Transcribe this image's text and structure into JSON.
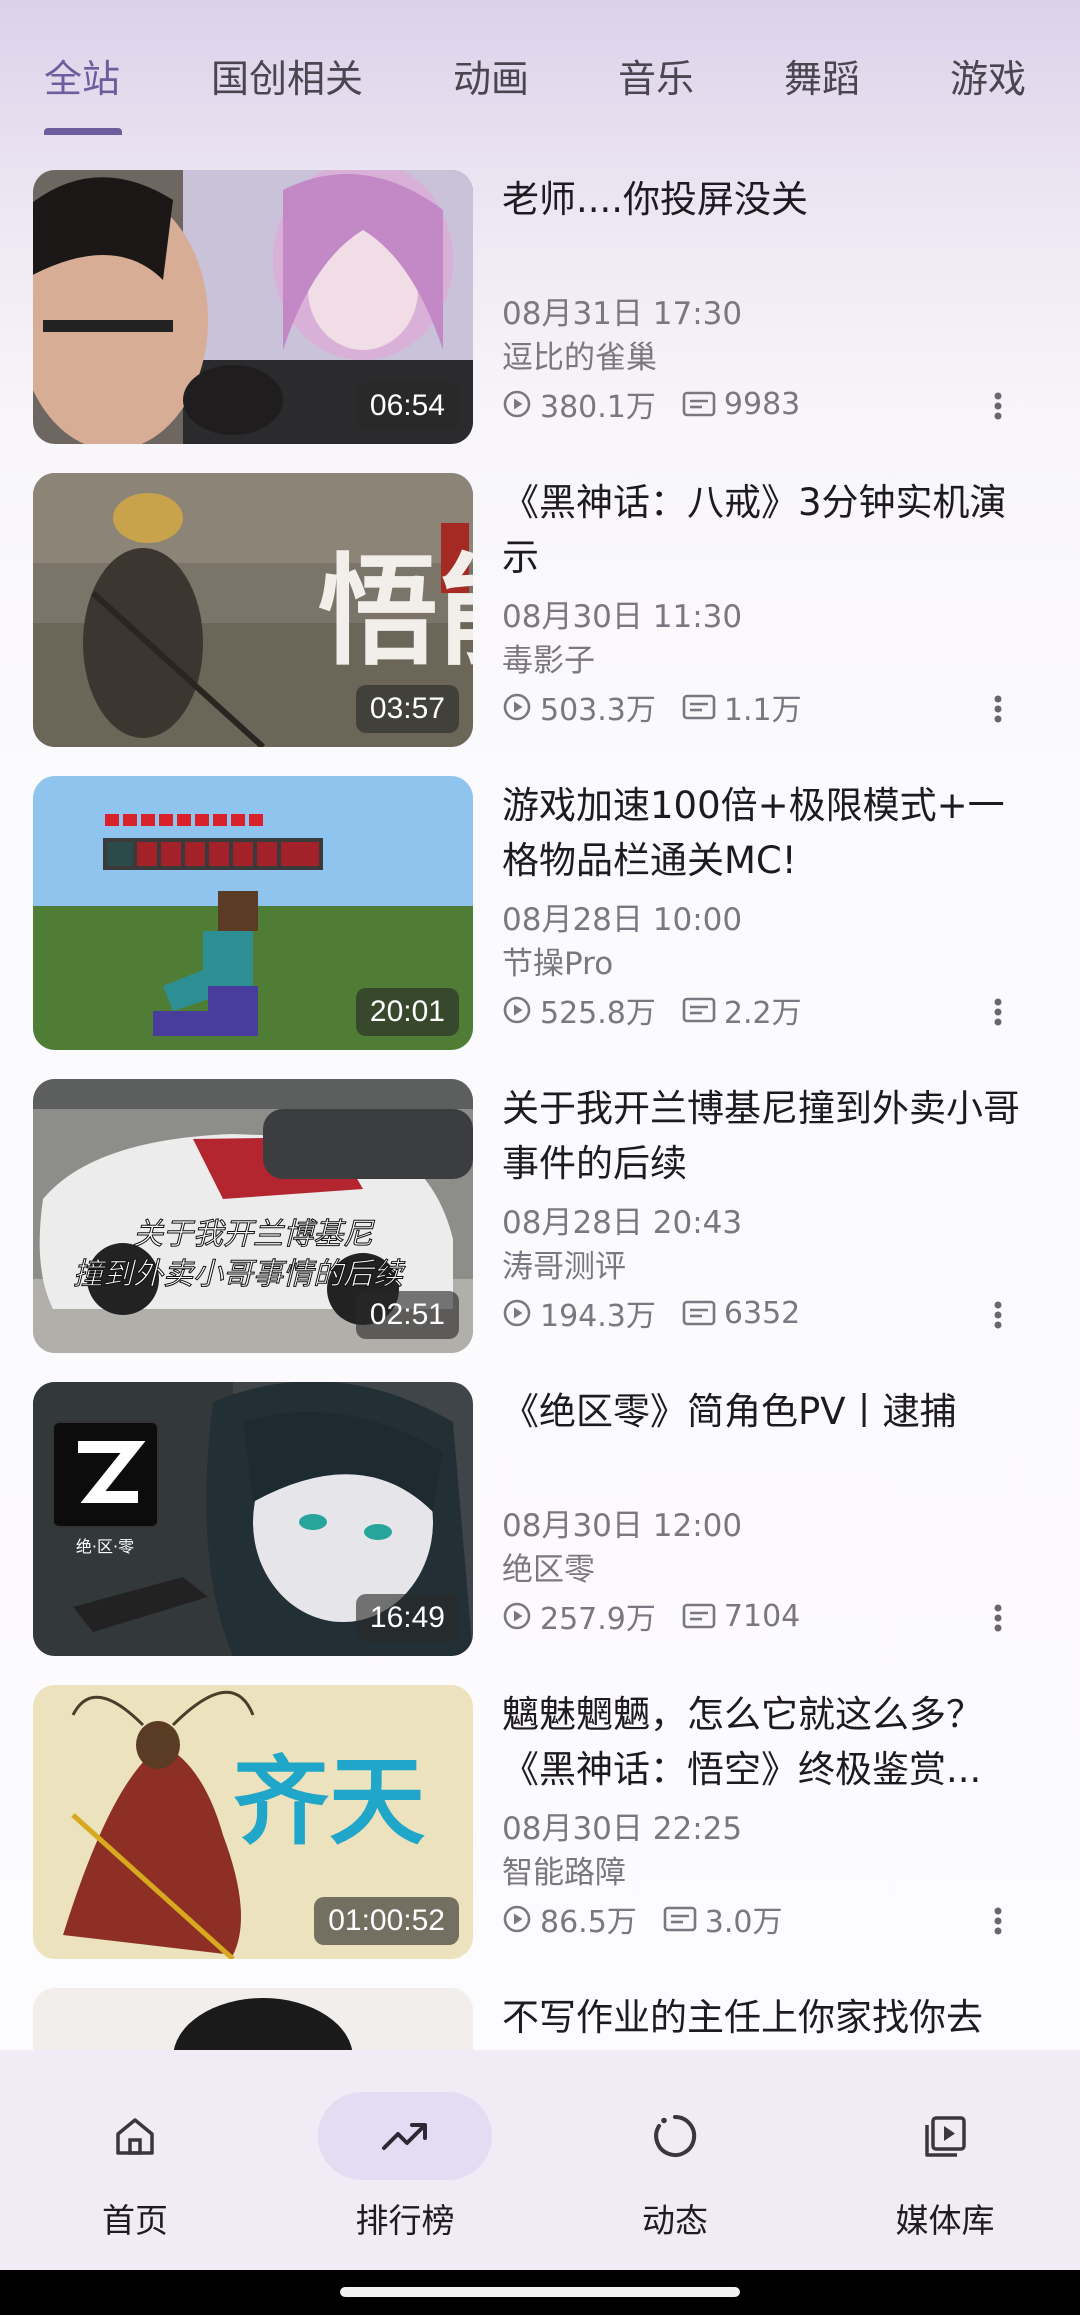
{
  "tabs": [
    {
      "label": "全站",
      "active": true
    },
    {
      "label": "国创相关"
    },
    {
      "label": "动画"
    },
    {
      "label": "音乐"
    },
    {
      "label": "舞蹈"
    },
    {
      "label": "游戏"
    }
  ],
  "colors": {
    "accent": "#6d5d9c",
    "meta_text": "#7b7781",
    "nav_active_bg": "#e4dcf3"
  },
  "videos": [
    {
      "title": "老师....你投屏没关",
      "date": "08月31日 17:30",
      "author": "逗比的雀巢",
      "views": "380.1万",
      "danmaku": "9983",
      "duration": "06:54"
    },
    {
      "title": "《黑神话：八戒》3分钟实机演示",
      "date": "08月30日 11:30",
      "author": "毒影子",
      "views": "503.3万",
      "danmaku": "1.1万",
      "duration": "03:57",
      "thumb_caption": "悟能"
    },
    {
      "title": "游戏加速100倍+极限模式+一格物品栏通关MC!",
      "date": "08月28日 10:00",
      "author": "节操Pro",
      "views": "525.8万",
      "danmaku": "2.2万",
      "duration": "20:01"
    },
    {
      "title": "关于我开兰博基尼撞到外卖小哥事件的后续",
      "date": "08月28日 20:43",
      "author": "涛哥测评",
      "views": "194.3万",
      "danmaku": "6352",
      "duration": "02:51",
      "thumb_caption_line1": "关于我开兰博基尼",
      "thumb_caption_line2": "撞到外卖小哥事情的后续"
    },
    {
      "title": "《绝区零》简角色PV丨逮捕",
      "date": "08月30日 12:00",
      "author": "绝区零",
      "views": "257.9万",
      "danmaku": "7104",
      "duration": "16:49",
      "thumb_logo_text": "绝·区·零"
    },
    {
      "title": "魑魅魍魉，怎么它就这么多？《黑神话：悟空》终极鉴赏...",
      "date": "08月30日 22:25",
      "author": "智能路障",
      "views": "86.5万",
      "danmaku": "3.0万",
      "duration": "01:00:52",
      "thumb_caption": "齐天"
    },
    {
      "title": "不写作业的主任上你家找你去"
    }
  ],
  "bottom_nav": [
    {
      "label": "首页",
      "icon": "home-icon"
    },
    {
      "label": "排行榜",
      "icon": "trending-icon",
      "active": true
    },
    {
      "label": "动态",
      "icon": "dynamic-icon"
    },
    {
      "label": "媒体库",
      "icon": "media-library-icon"
    }
  ]
}
